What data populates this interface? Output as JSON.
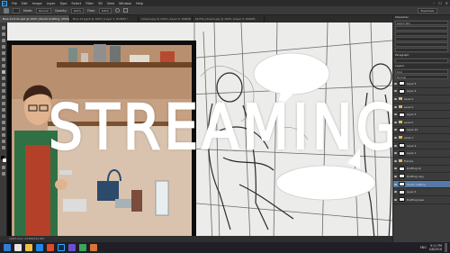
{
  "menu": {
    "app_logo": "Ps",
    "items": [
      "File",
      "Edit",
      "Image",
      "Layer",
      "Type",
      "Select",
      "Filter",
      "3D",
      "View",
      "Window",
      "Help"
    ]
  },
  "window_controls": {
    "minimize": "–",
    "maximize": "☐",
    "close": "✕"
  },
  "options_bar": {
    "mode_label": "Mode:",
    "mode_value": "Normal",
    "opacity_label": "Opacity:",
    "opacity_value": "100%",
    "flow_label": "Flow:",
    "flow_value": "100%",
    "workspace": "Essentials"
  },
  "document_tabs": [
    "Bios-13-P-21.psd @ 100% (Studio drafting, CMYK/8) *",
    "Bios-13-pgs5 @ 100% (Layer 1, RGB/8) *",
    "stream.jpg @ 100% (Layer 0, RGB/8) *",
    "bkdrfe_stream.jpg @ 100% (Layer 0, RGB/8)"
  ],
  "status_bar": "100%   Doc: 22.8M/312.6M",
  "overlay_title": "STREAMING",
  "panels": {
    "character_head": "Character",
    "paragraph_head": "Paragraph",
    "layers_head": "Layers",
    "font_value": "Avenir Std",
    "layer_kind": "Kind",
    "layer_mode": "Normal",
    "layers": [
      {
        "name": "Layer 5",
        "type": "layer"
      },
      {
        "name": "Layer 4",
        "type": "layer"
      },
      {
        "name": "Level 4",
        "type": "folder"
      },
      {
        "name": "Level 3",
        "type": "folder"
      },
      {
        "name": "Layer 3",
        "type": "layer"
      },
      {
        "name": "Level 2",
        "type": "folder"
      },
      {
        "name": "Layer 24",
        "type": "layer"
      },
      {
        "name": "Level 1",
        "type": "folder"
      },
      {
        "name": "Layer 2",
        "type": "layer"
      },
      {
        "name": "Layer 1",
        "type": "layer"
      },
      {
        "name": "Frames",
        "type": "folder"
      },
      {
        "name": "Drafting slc",
        "type": "layer"
      },
      {
        "name": "Drafting copy",
        "type": "layer"
      },
      {
        "name": "Studio drafting",
        "type": "layer",
        "selected": true
      },
      {
        "name": "Layer 4",
        "type": "layer"
      },
      {
        "name": "Drafting base",
        "type": "layer"
      }
    ]
  },
  "tray": {
    "lang": "ENG",
    "time": "9:11 PM",
    "date": "4/8/2016"
  },
  "colors": {
    "accent": "#31a8ff",
    "selected_layer": "#557aa8",
    "frame": "#0d0d0d",
    "title": "#ffffff"
  }
}
